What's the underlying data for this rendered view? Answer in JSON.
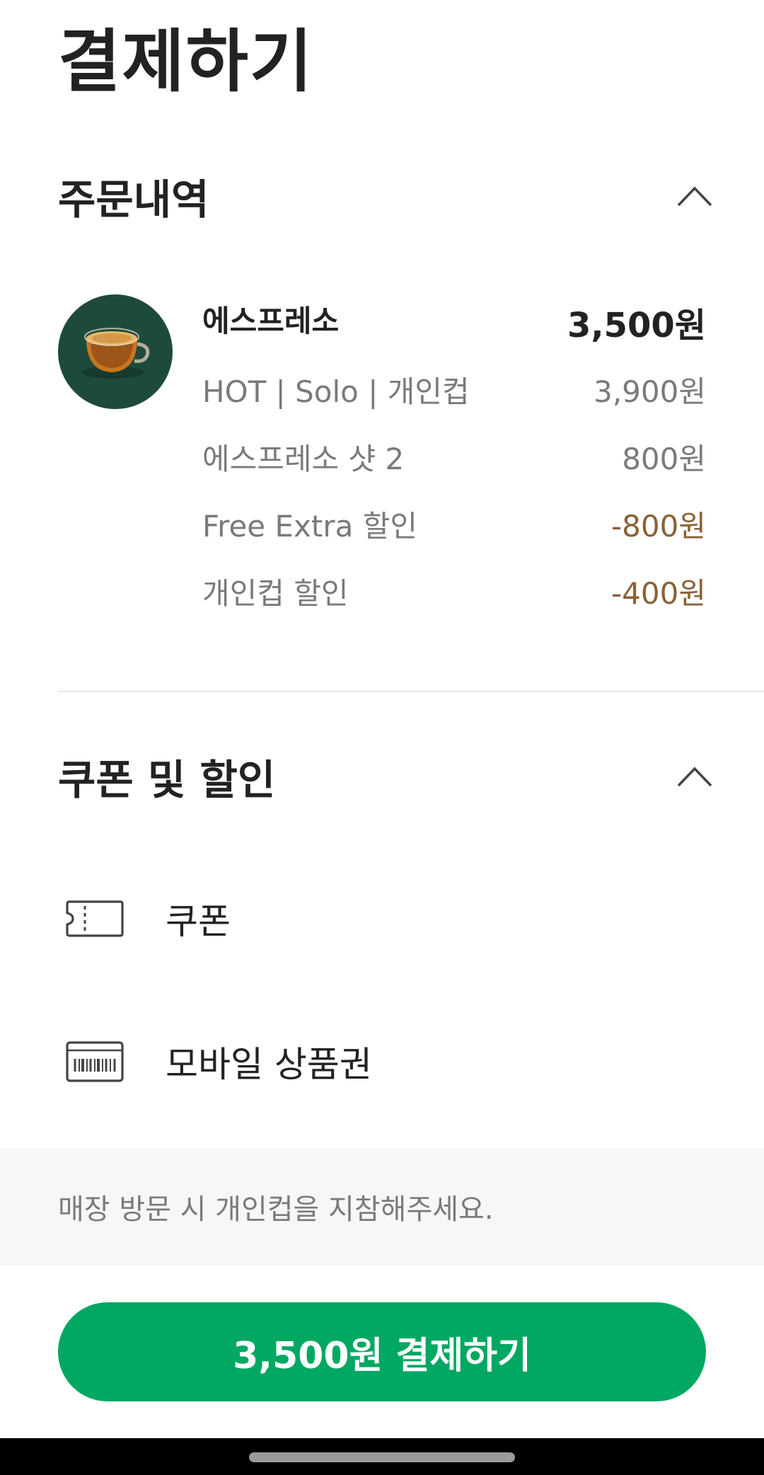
{
  "page": {
    "title": "결제하기"
  },
  "order_section": {
    "title": "주문내역",
    "toggle_icon": "chevron-up-icon",
    "item": {
      "image": "espresso-cup-image",
      "name": "에스프레소",
      "total": "3,500원",
      "details": [
        {
          "label": "HOT | Solo | 개인컵",
          "amount": "3,900원",
          "is_discount": false
        },
        {
          "label": "에스프레소 샷 2",
          "amount": "800원",
          "is_discount": false
        },
        {
          "label": "Free Extra 할인",
          "amount": "-800원",
          "is_discount": true
        },
        {
          "label": "개인컵 할인",
          "amount": "-400원",
          "is_discount": true
        }
      ]
    }
  },
  "discount_section": {
    "title": "쿠폰 및 할인",
    "toggle_icon": "chevron-up-icon",
    "items": [
      {
        "icon": "coupon-ticket-icon",
        "label": "쿠폰"
      },
      {
        "icon": "gift-card-barcode-icon",
        "label": "모바일 상품권"
      }
    ]
  },
  "notice": {
    "text": "매장 방문 시 개인컵을 지참해주세요."
  },
  "pay_button": {
    "label": "3,500원 결제하기"
  },
  "colors": {
    "accent_green": "#00a862",
    "discount_brown": "#8a6136",
    "thumb_bg": "#1e4a3c",
    "notice_bg": "#f7f7f7"
  }
}
